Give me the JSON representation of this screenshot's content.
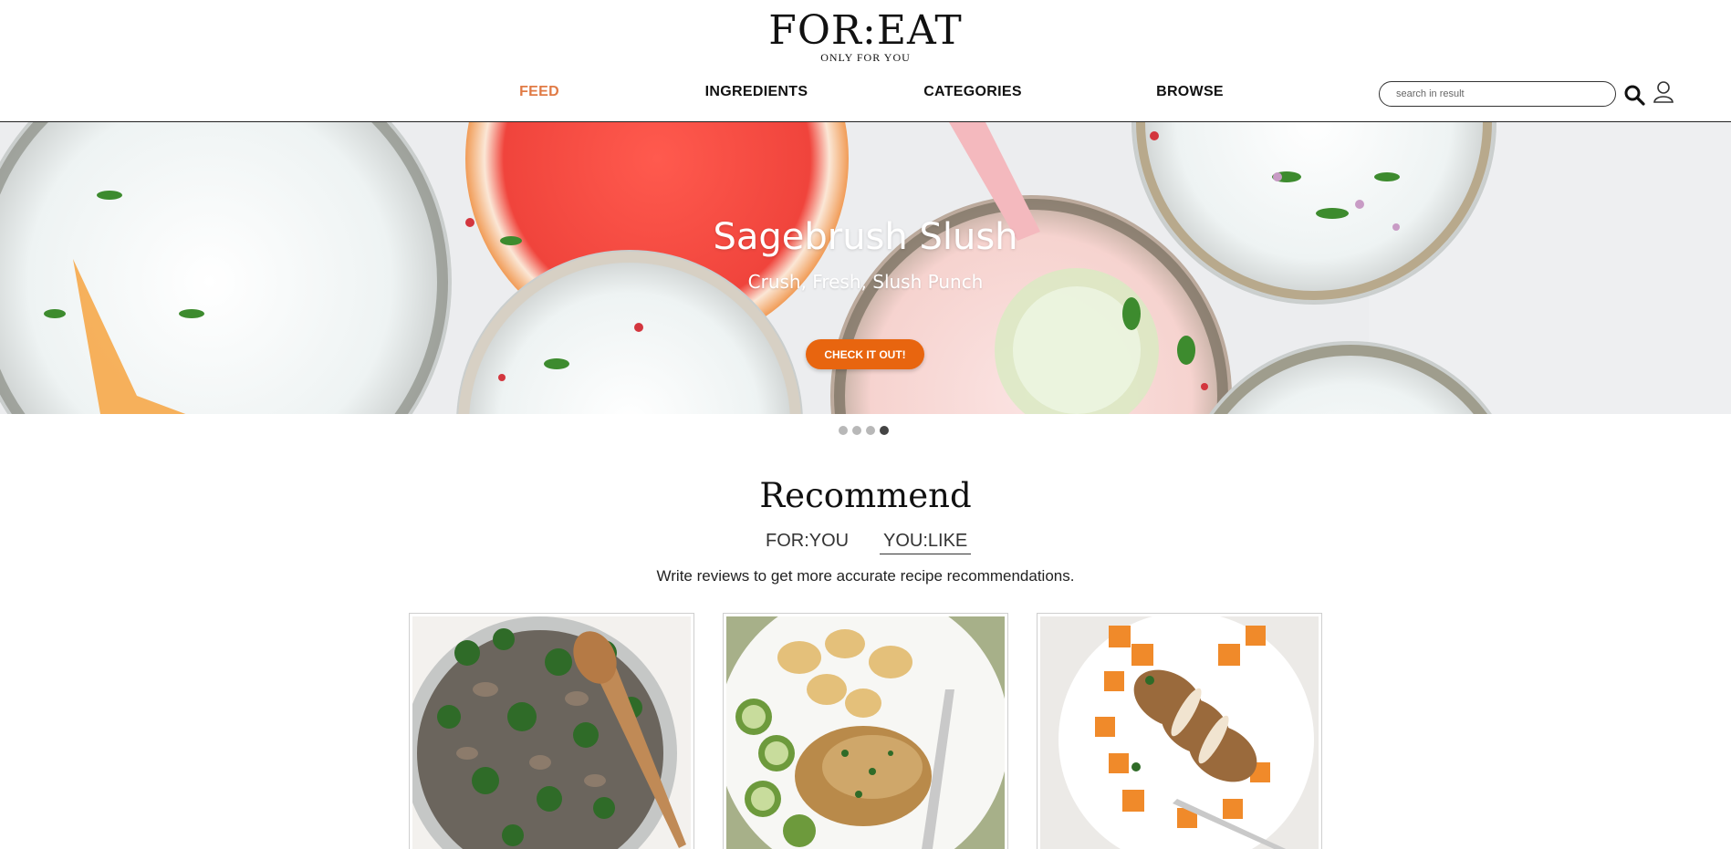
{
  "header": {
    "logo_title": "FOR:EAT",
    "logo_subtitle": "ONLY FOR YOU",
    "nav": [
      {
        "label": "FEED",
        "active": true
      },
      {
        "label": "INGREDIENTS",
        "active": false
      },
      {
        "label": "CATEGORIES",
        "active": false
      },
      {
        "label": "BROWSE",
        "active": false
      }
    ],
    "search_placeholder": "search in result",
    "icons": [
      "search-icon",
      "user-icon"
    ]
  },
  "hero": {
    "title": "Sagebrush Slush",
    "subtitle": "Crush, Fresh, Slush Punch",
    "button_label": "CHECK IT OUT!",
    "slide_count": 4,
    "active_slide": 4
  },
  "recommend": {
    "title": "Recommend",
    "tabs": [
      {
        "label": "FOR:YOU",
        "active": false
      },
      {
        "label": "YOU:LIKE",
        "active": true
      }
    ],
    "description": "Write reviews to get more accurate recipe recommendations."
  },
  "cards": [
    {
      "image": "broccoli-mushroom-skillet"
    },
    {
      "image": "chicken-potatoes-zucchini"
    },
    {
      "image": "sliced-chicken-sweet-potato"
    }
  ],
  "colors": {
    "accent": "#e07a45",
    "button": "#e8650f"
  }
}
